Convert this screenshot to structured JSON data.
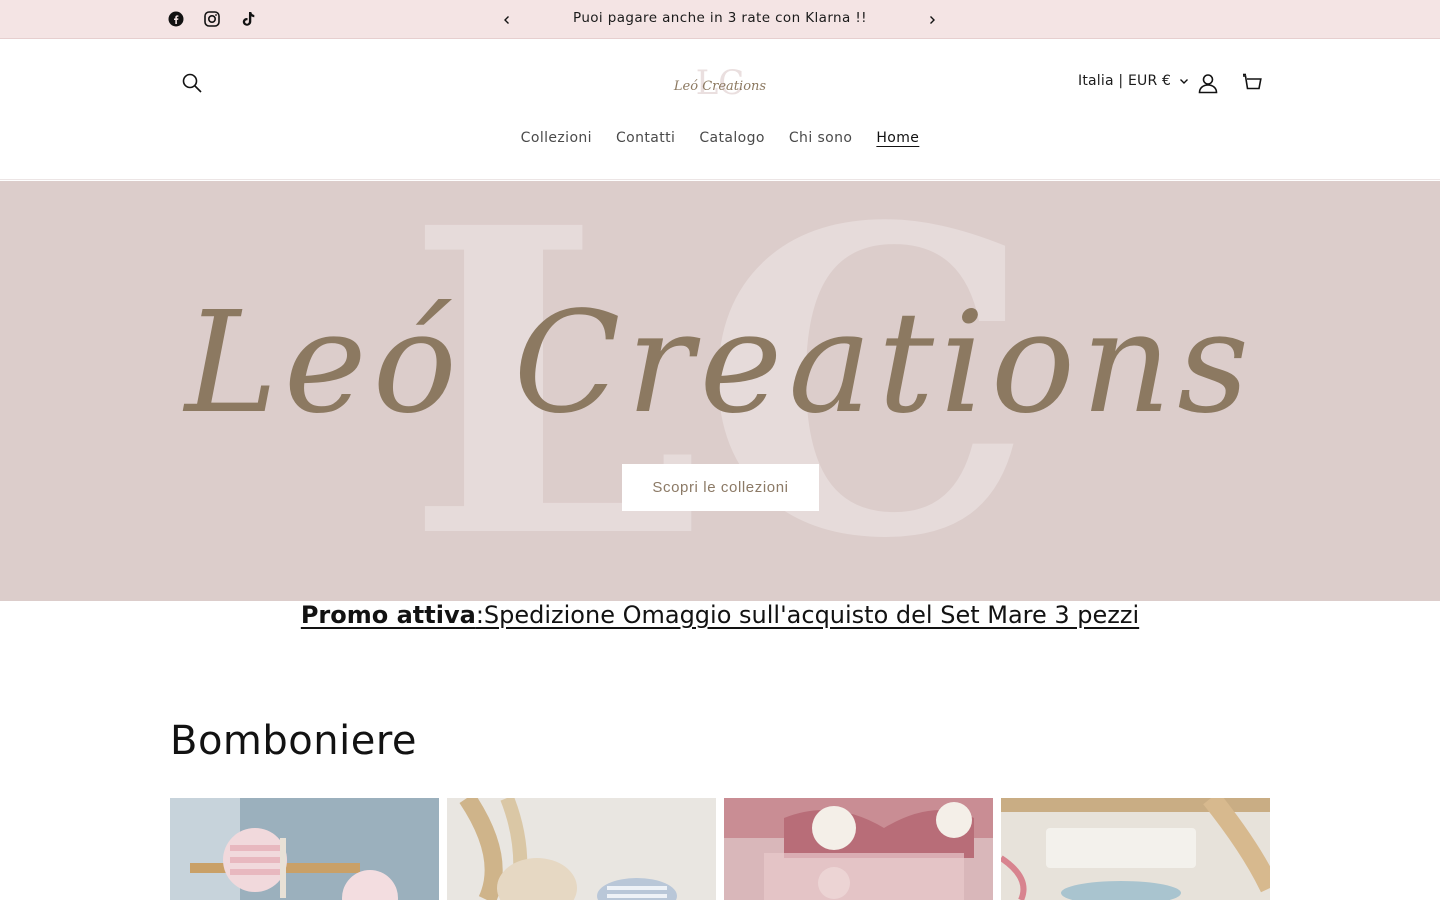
{
  "announcement": {
    "social": [
      {
        "name": "facebook-icon"
      },
      {
        "name": "instagram-icon"
      },
      {
        "name": "tiktok-icon"
      }
    ],
    "message": "Puoi pagare anche in 3 rate con Klarna !!",
    "prev_icon": "chevron-left-icon",
    "next_icon": "chevron-right-icon"
  },
  "header": {
    "logo_alt": "Leó Creations",
    "locale": "Italia | EUR €",
    "nav": [
      {
        "label": "Collezioni"
      },
      {
        "label": "Contatti"
      },
      {
        "label": "Catalogo"
      },
      {
        "label": "Chi sono"
      },
      {
        "label": "Home",
        "active": true
      }
    ]
  },
  "hero": {
    "logo_text": "Leó Creations",
    "watermark": "LC",
    "cta_label": "Scopri le collezioni",
    "colors": {
      "background": "#dccdcb",
      "script": "#8c7961",
      "watermark": "#e6dbda"
    }
  },
  "promo": {
    "bold": "Promo attiva",
    "text": ":Spedizione Omaggio sull'acquisto del Set Mare 3 pezzi"
  },
  "collection": {
    "title": "Bomboniere",
    "cards": [
      {
        "name": "bomboniera-card-1"
      },
      {
        "name": "bomboniera-card-2"
      },
      {
        "name": "bomboniera-card-3"
      },
      {
        "name": "bomboniera-card-4"
      }
    ]
  }
}
